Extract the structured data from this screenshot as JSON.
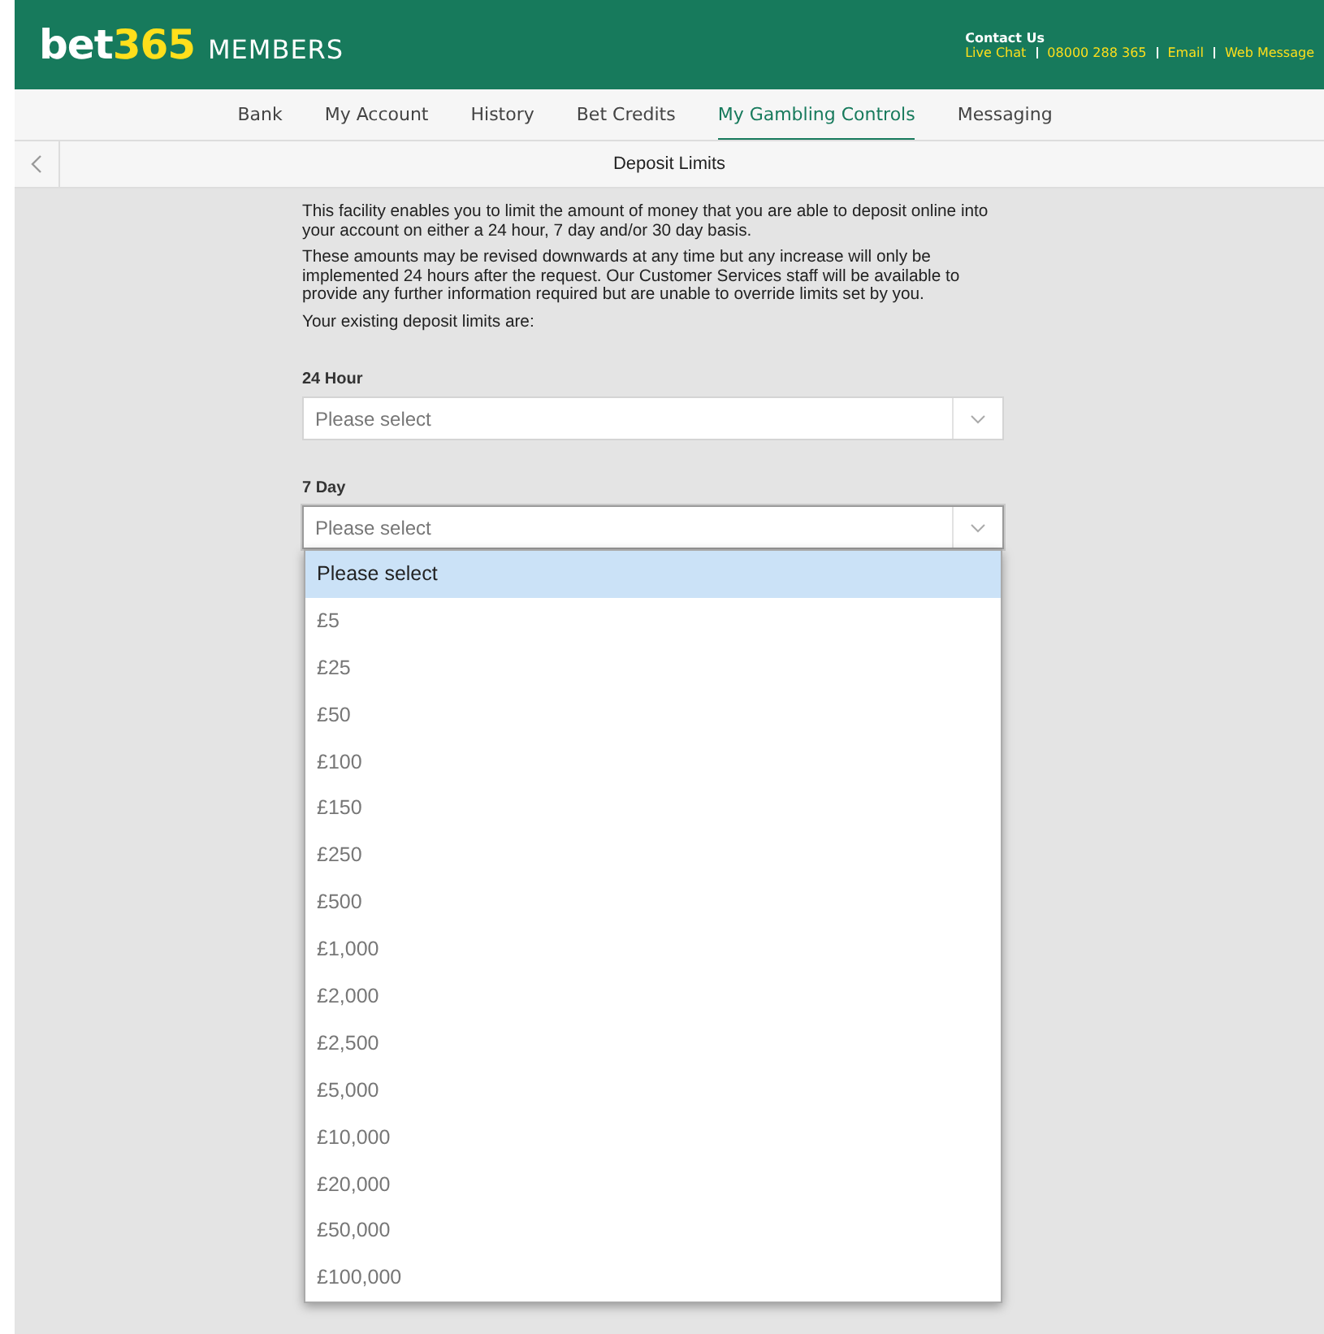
{
  "header": {
    "logo": {
      "main": "bet",
      "accent": "365",
      "suffix": "MEMBERS"
    },
    "contact": {
      "title": "Contact Us",
      "links": [
        "Live Chat",
        "08000 288 365",
        "Email",
        "Web Message"
      ]
    }
  },
  "nav": [
    {
      "label": "Bank",
      "selected": false
    },
    {
      "label": "My Account",
      "selected": false
    },
    {
      "label": "History",
      "selected": false
    },
    {
      "label": "Bet Credits",
      "selected": false
    },
    {
      "label": "My Gambling Controls",
      "selected": true
    },
    {
      "label": "Messaging",
      "selected": false
    }
  ],
  "page_title": "Deposit Limits",
  "paragraphs": [
    "This facility enables you to limit the amount of money that you are able to deposit online into your account on either a 24 hour, 7 day and/or 30 day basis.",
    "These amounts may be revised downwards at any time but any increase will only be implemented 24 hours after the request. Our Customer Services staff will be available to provide any further information required but are unable to override limits set by you.",
    "Your existing deposit limits are:"
  ],
  "fields": [
    {
      "label": "24 Hour",
      "placeholder": "Please select",
      "expanded": false
    },
    {
      "label": "7 Day",
      "placeholder": "Please select",
      "expanded": true
    }
  ],
  "dropdown": [
    {
      "label": "Please select",
      "selected": true
    },
    {
      "label": "£5",
      "selected": false
    },
    {
      "label": "£25",
      "selected": false
    },
    {
      "label": "£50",
      "selected": false
    },
    {
      "label": "£100",
      "selected": false
    },
    {
      "label": "£150",
      "selected": false
    },
    {
      "label": "£250",
      "selected": false
    },
    {
      "label": "£500",
      "selected": false
    },
    {
      "label": "£1,000",
      "selected": false
    },
    {
      "label": "£2,000",
      "selected": false
    },
    {
      "label": "£2,500",
      "selected": false
    },
    {
      "label": "£5,000",
      "selected": false
    },
    {
      "label": "£10,000",
      "selected": false
    },
    {
      "label": "£20,000",
      "selected": false
    },
    {
      "label": "£50,000",
      "selected": false
    },
    {
      "label": "£100,000",
      "selected": false
    }
  ]
}
